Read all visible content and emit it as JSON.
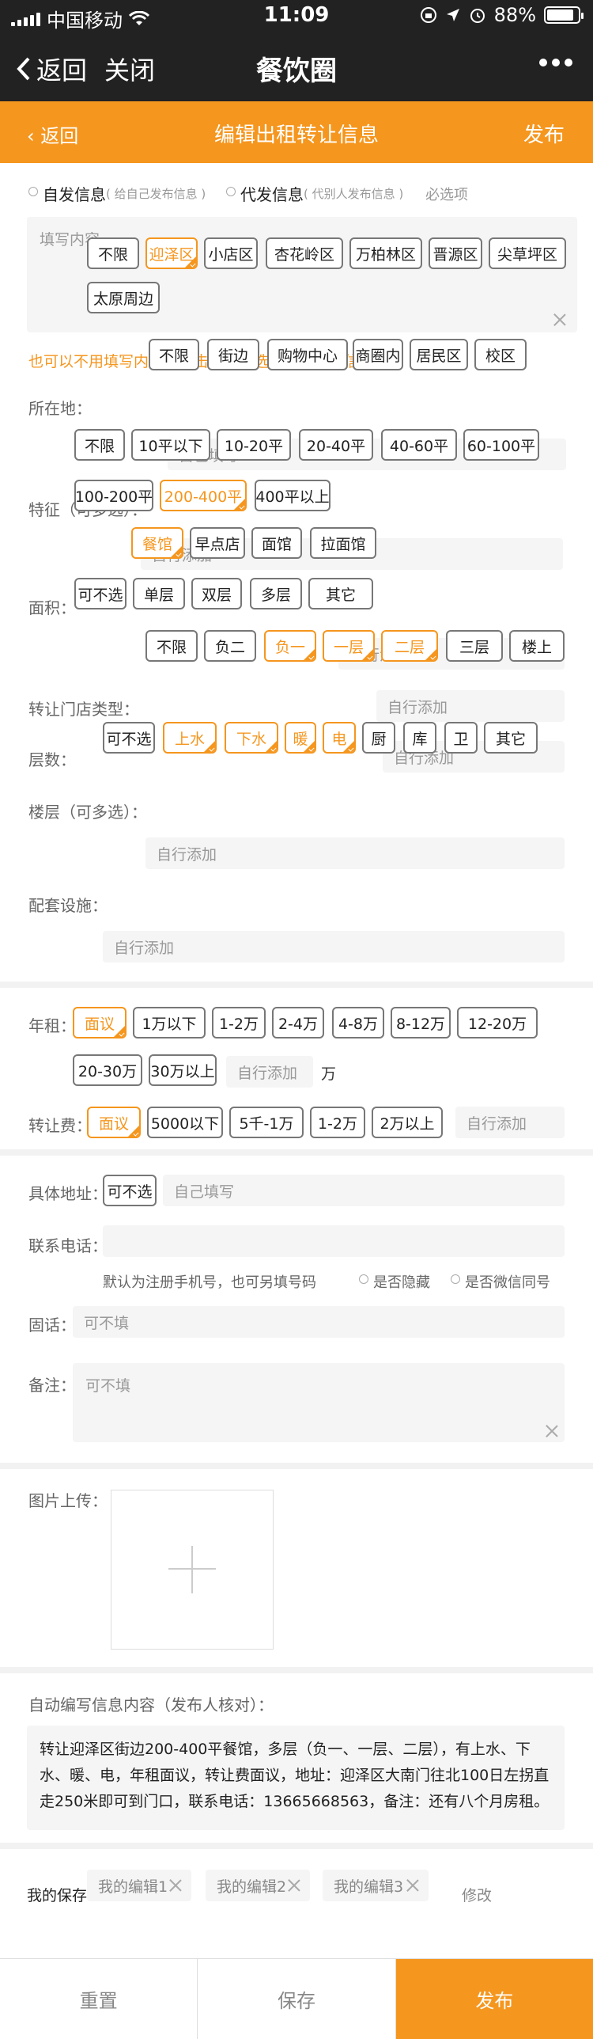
{
  "status": {
    "carrier": "中国移动",
    "time": "11:09",
    "battery": "88%",
    "battery_level": 0.88
  },
  "nav": {
    "back": "返回",
    "close": "关闭",
    "title": "餐饮圈"
  },
  "header": {
    "back": "返回",
    "title": "编辑出租转让信息",
    "publish": "发布"
  },
  "publish_mode": {
    "self_label": "自发信息",
    "self_note": "( 给自己发布信息 )",
    "proxy_label": "代发信息",
    "proxy_note": "( 代别人发布信息 )",
    "required": "必选项",
    "content_placeholder": "填写内容"
  },
  "hint": "也可以不用填写内容，点击下面的选项自动编辑信息：",
  "location": {
    "label": "所在地：",
    "options": [
      "不限",
      "迎泽区",
      "小店区",
      "杏花岭区",
      "万柏林区",
      "晋源区",
      "尖草坪区",
      "太原周边"
    ],
    "selected": "迎泽区",
    "custom_placeholder": "自己填写"
  },
  "feature": {
    "label": "特征（可多选）：",
    "options": [
      "不限",
      "街边",
      "购物中心",
      "商圈内",
      "居民区",
      "校区"
    ],
    "custom_placeholder": "自行添加"
  },
  "area": {
    "label": "面积：",
    "options": [
      "不限",
      "10平以下",
      "10-20平",
      "20-40平",
      "40-60平",
      "60-100平",
      "100-200平",
      "200-400平",
      "400平以上"
    ],
    "selected": "200-400平",
    "custom_placeholder": "自行添加"
  },
  "shop_type": {
    "label": "转让门店类型：",
    "options": [
      "餐馆",
      "早点店",
      "面馆",
      "拉面馆"
    ],
    "selected": "餐馆",
    "custom_placeholder": "自行添加"
  },
  "layers": {
    "label": "层数：",
    "options": [
      "可不选",
      "单层",
      "双层",
      "多层",
      "其它"
    ],
    "custom_placeholder": "自行添加"
  },
  "floor": {
    "label": "楼层（可多选）：",
    "options": [
      "不限",
      "负二",
      "负一",
      "一层",
      "二层",
      "三层",
      "楼上"
    ],
    "selected": [
      "负一",
      "一层",
      "二层"
    ],
    "custom_placeholder": "自行添加"
  },
  "facilities": {
    "label": "配套设施：",
    "options": [
      "可不选",
      "上水",
      "下水",
      "暖",
      "电",
      "厨",
      "库",
      "卫",
      "其它"
    ],
    "selected": [
      "上水",
      "下水",
      "暖",
      "电"
    ],
    "custom_placeholder": "自行添加"
  },
  "rent": {
    "label": "年租：",
    "options": [
      "面议",
      "1万以下",
      "1-2万",
      "2-4万",
      "4-8万",
      "8-12万",
      "12-20万",
      "20-30万",
      "30万以上"
    ],
    "selected": "面议",
    "custom_placeholder": "自行添加",
    "unit": "万"
  },
  "transfer_fee": {
    "label": "转让费：",
    "options": [
      "面议",
      "5000以下",
      "5千-1万",
      "1-2万",
      "2万以上"
    ],
    "selected": "面议",
    "custom_placeholder": "自行添加"
  },
  "address": {
    "label": "具体地址：",
    "option": "可不选",
    "placeholder": "自己填写"
  },
  "phone": {
    "label": "联系电话：",
    "note": "默认为注册手机号，也可另填号码",
    "hide": "是否隐藏",
    "wechat": "是否微信同号"
  },
  "landline": {
    "label": "固话：",
    "placeholder": "可不填"
  },
  "remark": {
    "label": "备注：",
    "placeholder": "可不填"
  },
  "image_upload": {
    "label": "图片上传："
  },
  "auto_content": {
    "label": "自动编写信息内容（发布人核对）：",
    "text": "转让迎泽区街边200-400平餐馆，多层（负一、一层、二层），有上水、下水、暖、电，年租面议，转让费面议，地址：迎泽区大南门往北100日左拐直走250米即可到门口，联系电话：13665668563，备注：还有八个月房租。"
  },
  "saved": {
    "label": "我的保存：",
    "items": [
      "我的编辑1",
      "我的编辑2",
      "我的编辑3"
    ],
    "edit": "修改"
  },
  "bottom": {
    "reset": "重置",
    "save": "保存",
    "publish": "发布"
  },
  "colors": {
    "accent": "#f5961e",
    "nav_bg": "#222222"
  }
}
